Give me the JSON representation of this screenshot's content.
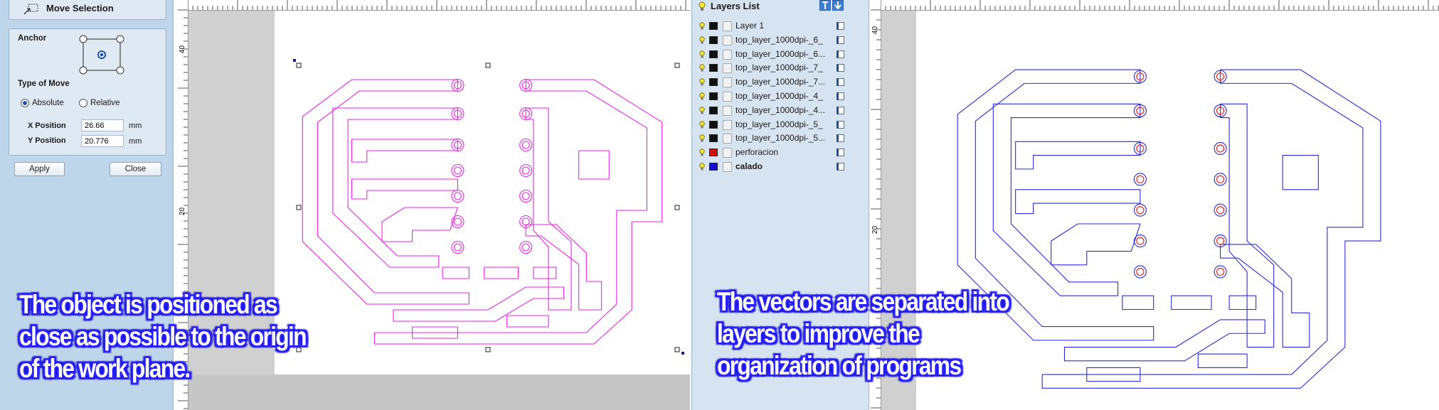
{
  "move_selection": {
    "title": "Move Selection",
    "anchor_label": "Anchor",
    "type_of_move_label": "Type of Move",
    "absolute_label": "Absolute",
    "relative_label": "Relative",
    "selected_move": "Absolute",
    "x_position_label": "X Position",
    "x_position_value": "26.66",
    "x_unit": "mm",
    "y_position_label": "Y Position",
    "y_position_value": "20.776",
    "y_unit": "mm",
    "apply_label": "Apply",
    "close_label": "Close"
  },
  "left_canvas": {
    "ruler_left_labels": [
      "40",
      "20"
    ],
    "vector_color": "#ee22ee"
  },
  "right_canvas": {
    "ruler_left_labels": [
      "40",
      "20"
    ],
    "vector_color": "#2a2ae0",
    "drill_color": "#e01818"
  },
  "layers_panel": {
    "title": "Layers List",
    "layers": [
      {
        "name": "Layer 1",
        "color": "#111111",
        "bold": false
      },
      {
        "name": "top_layer_1000dpi-_6_",
        "color": "#111111",
        "bold": false
      },
      {
        "name": "top_layer_1000dpi-_6...",
        "color": "#111111",
        "bold": false
      },
      {
        "name": "top_layer_1000dpi-_7_",
        "color": "#111111",
        "bold": false
      },
      {
        "name": "top_layer_1000dpi-_7...",
        "color": "#111111",
        "bold": false
      },
      {
        "name": "top_layer_1000dpi-_4_",
        "color": "#111111",
        "bold": false
      },
      {
        "name": "top_layer_1000dpi-_4...",
        "color": "#111111",
        "bold": false
      },
      {
        "name": "top_layer_1000dpi-_5_",
        "color": "#111111",
        "bold": false
      },
      {
        "name": "top_layer_1000dpi-_5...",
        "color": "#111111",
        "bold": false
      },
      {
        "name": "perforacion",
        "color": "#cc1111",
        "bold": false
      },
      {
        "name": "calado",
        "color": "#1111cc",
        "bold": true
      }
    ]
  },
  "captions": {
    "left": "The object is positioned as\nclose as possible to the origin\nof the work plane.",
    "right": "The vectors are separated into\nlayers to improve the\norganization of programs"
  },
  "colors": {
    "caption_outline": "#2b22ff",
    "panel_bg": "#bfd6ea"
  }
}
